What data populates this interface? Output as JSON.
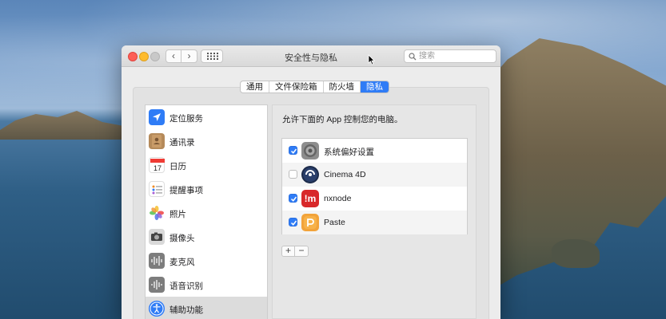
{
  "window": {
    "title": "安全性与隐私",
    "search_placeholder": "搜索"
  },
  "tabs": [
    {
      "label": "通用",
      "active": false
    },
    {
      "label": "文件保险箱",
      "active": false
    },
    {
      "label": "防火墙",
      "active": false
    },
    {
      "label": "隐私",
      "active": true
    }
  ],
  "sidebar": {
    "items": [
      {
        "label": "定位服务",
        "icon": "location-arrow-icon"
      },
      {
        "label": "通讯录",
        "icon": "contacts-book-icon"
      },
      {
        "label": "日历",
        "icon": "calendar-icon"
      },
      {
        "label": "提醒事项",
        "icon": "reminders-icon"
      },
      {
        "label": "照片",
        "icon": "photos-icon"
      },
      {
        "label": "摄像头",
        "icon": "camera-icon"
      },
      {
        "label": "麦克风",
        "icon": "microphone-icon"
      },
      {
        "label": "语音识别",
        "icon": "speech-waveform-icon"
      },
      {
        "label": "辅助功能",
        "icon": "accessibility-icon",
        "selected": true
      }
    ],
    "calendar_day": "17"
  },
  "pane": {
    "description": "允许下面的 App 控制您的电脑。",
    "apps": [
      {
        "label": "系统偏好设置",
        "checked": true,
        "icon": "system-preferences-gear-icon"
      },
      {
        "label": "Cinema 4D",
        "checked": false,
        "icon": "cinema4d-icon"
      },
      {
        "label": "nxnode",
        "checked": true,
        "icon": "nxnode-icon",
        "icon_text": "!m"
      },
      {
        "label": "Paste",
        "checked": true,
        "icon": "paste-icon"
      }
    ],
    "add_label": "+",
    "remove_label": "−"
  },
  "nav": {
    "back_label": "‹",
    "forward_label": "›"
  },
  "colors": {
    "accent": "#2f7cf6",
    "close": "#fd5f57",
    "minimize": "#febb2e"
  }
}
